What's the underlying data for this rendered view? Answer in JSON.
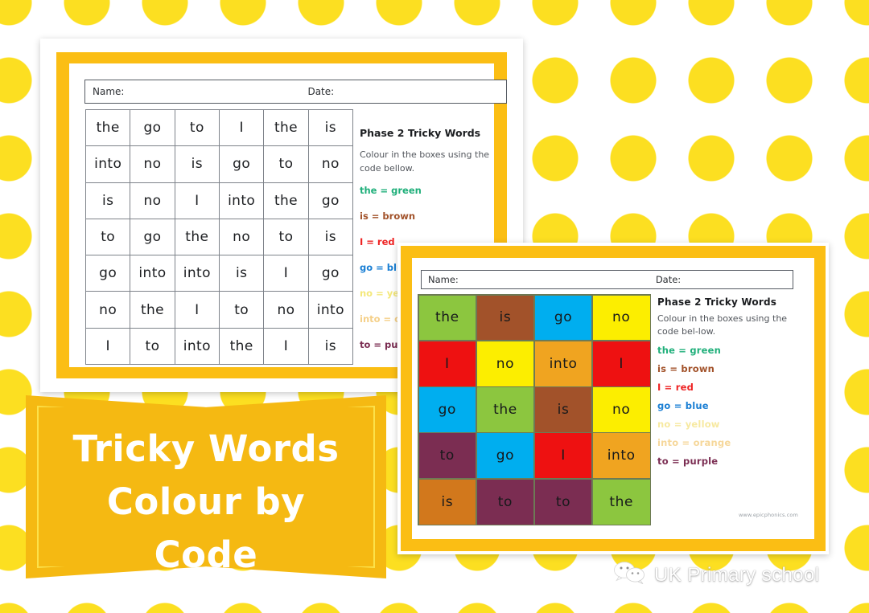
{
  "banner": {
    "line1": "Tricky Words",
    "line2": "Colour by",
    "line3": "Code",
    "bg_color": "#F5B912",
    "outline_color": "#FCE24A",
    "text_color": "#FFFFFF"
  },
  "background": {
    "dot_color": "#FCDF21",
    "base_color": "#FFFFFF"
  },
  "brand": {
    "label": "UK Primary school",
    "icon": "wechat-icon"
  },
  "palette": {
    "green": "#8CC63F",
    "brown": "#A2522A",
    "blue": "#00AEEF",
    "yellow": "#FCEE00",
    "red": "#EE1111",
    "orange": "#F0A420",
    "orange_dark": "#D2781C",
    "purple": "#7B2D52"
  },
  "worksheet1": {
    "frame_color": "#FBBE14",
    "namebar": {
      "name_label": "Name:",
      "date_label": "Date:"
    },
    "grid": {
      "columns": 6,
      "rows": 7,
      "cells": [
        [
          "the",
          "go",
          "to",
          "I",
          "the",
          "is"
        ],
        [
          "into",
          "no",
          "is",
          "go",
          "to",
          "no"
        ],
        [
          "is",
          "no",
          "I",
          "into",
          "the",
          "go"
        ],
        [
          "to",
          "go",
          "the",
          "no",
          "to",
          "is"
        ],
        [
          "go",
          "into",
          "into",
          "is",
          "I",
          "go"
        ],
        [
          "no",
          "the",
          "I",
          "to",
          "no",
          "into"
        ],
        [
          "I",
          "to",
          "into",
          "the",
          "I",
          "is"
        ]
      ]
    },
    "legend": {
      "title": "Phase 2 Tricky Words",
      "description": "Colour in the boxes using the code bellow.",
      "items": [
        {
          "text": "the = green",
          "color": "#1FAF7A"
        },
        {
          "text": "is = brown",
          "color": "#A2522A"
        },
        {
          "text": "I = red",
          "color": "#EE2222"
        },
        {
          "text": "go = blue",
          "color": "#1A7FD4"
        },
        {
          "text": "no = yellow",
          "color": "#F4E87A"
        },
        {
          "text": "into = orange",
          "color": "#F5D089"
        },
        {
          "text": "to = purple",
          "color": "#7B2D52"
        }
      ]
    }
  },
  "worksheet2": {
    "frame_color": "#FBBE14",
    "namebar": {
      "name_label": "Name:",
      "date_label": "Date:"
    },
    "grid": {
      "columns": 4,
      "rows": 5,
      "cells": [
        [
          {
            "word": "the",
            "color": "#8CC63F"
          },
          {
            "word": "is",
            "color": "#A2522A"
          },
          {
            "word": "go",
            "color": "#00AEEF"
          },
          {
            "word": "no",
            "color": "#FCEE00"
          }
        ],
        [
          {
            "word": "I",
            "color": "#EE1111"
          },
          {
            "word": "no",
            "color": "#FCEE00"
          },
          {
            "word": "into",
            "color": "#F0A420"
          },
          {
            "word": "I",
            "color": "#EE1111"
          }
        ],
        [
          {
            "word": "go",
            "color": "#00AEEF"
          },
          {
            "word": "the",
            "color": "#8CC63F"
          },
          {
            "word": "is",
            "color": "#A2522A"
          },
          {
            "word": "no",
            "color": "#FCEE00"
          }
        ],
        [
          {
            "word": "to",
            "color": "#7B2D52"
          },
          {
            "word": "go",
            "color": "#00AEEF"
          },
          {
            "word": "I",
            "color": "#EE1111"
          },
          {
            "word": "into",
            "color": "#F0A420"
          }
        ],
        [
          {
            "word": "is",
            "color": "#D2781C"
          },
          {
            "word": "to",
            "color": "#7B2D52"
          },
          {
            "word": "to",
            "color": "#7B2D52"
          },
          {
            "word": "the",
            "color": "#8CC63F"
          }
        ]
      ]
    },
    "legend": {
      "title": "Phase 2 Tricky Words",
      "description": "Colour in the boxes using the code bel-low.",
      "items": [
        {
          "text": "the = green",
          "color": "#1FAF7A"
        },
        {
          "text": "is = brown",
          "color": "#A2522A"
        },
        {
          "text": "I = red",
          "color": "#EE2222"
        },
        {
          "text": "go = blue",
          "color": "#1A7FD4"
        },
        {
          "text": "no = yellow",
          "color": "#F7E9A0"
        },
        {
          "text": "into = orange",
          "color": "#F6D79A"
        },
        {
          "text": "to = purple",
          "color": "#7B2D52"
        }
      ]
    },
    "watermark": "www.epicphonics.com"
  }
}
